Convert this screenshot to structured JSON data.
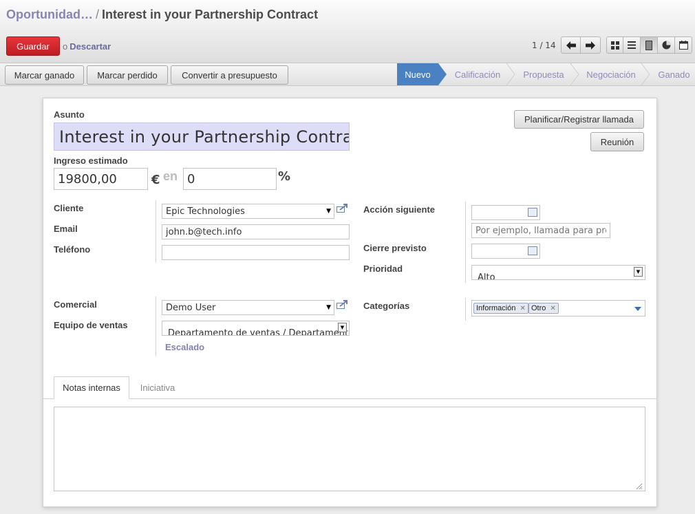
{
  "breadcrumb": {
    "parent": "Oportunidad…",
    "separator": "/",
    "current": "Interest in your Partnership Contract"
  },
  "toolbar": {
    "save_label": "Guardar",
    "or_label": "o",
    "discard_label": "Descartar"
  },
  "pager": {
    "text": "1 / 14"
  },
  "status_buttons": {
    "won": "Marcar ganado",
    "lost": "Marcar perdido",
    "quote": "Convertir a presupuesto"
  },
  "stages": [
    "Nuevo",
    "Calificación",
    "Propuesta",
    "Negociación",
    "Ganado"
  ],
  "form": {
    "subject_label": "Asunto",
    "subject_value": "Interest in your Partnership Contract",
    "revenue_label": "Ingreso estimado",
    "revenue_value": "19800,00",
    "currency": "€",
    "in_label": "en",
    "probability_value": "0",
    "percent": "%",
    "call_button": "Planificar/Registrar llamada",
    "meeting_button": "Reunión",
    "customer_label": "Cliente",
    "customer_value": "Epic Technologies",
    "email_label": "Email",
    "email_value": "john.b@tech.info",
    "phone_label": "Teléfono",
    "phone_value": "",
    "next_action_label": "Acción siguiente",
    "next_action_date": "",
    "next_action_placeholder": "Por ejemplo, llamada para presupuesto",
    "closing_label": "Cierre previsto",
    "closing_date": "",
    "priority_label": "Prioridad",
    "priority_value": "Alto",
    "salesperson_label": "Comercial",
    "salesperson_value": "Demo User",
    "team_label": "Equipo de ventas",
    "team_value": "Departamento de ventas / Departamento",
    "escalate_label": "Escalado",
    "categories_label": "Categorías",
    "categories": [
      "Información",
      "Otro"
    ]
  },
  "tabs": [
    "Notas internas",
    "Iniciativa"
  ],
  "notes_value": "",
  "colors": {
    "primary_button": "#c7252b",
    "active_stage": "#4a81c3",
    "link": "#6a6a9e",
    "highlight_field": "#ddddf8"
  }
}
